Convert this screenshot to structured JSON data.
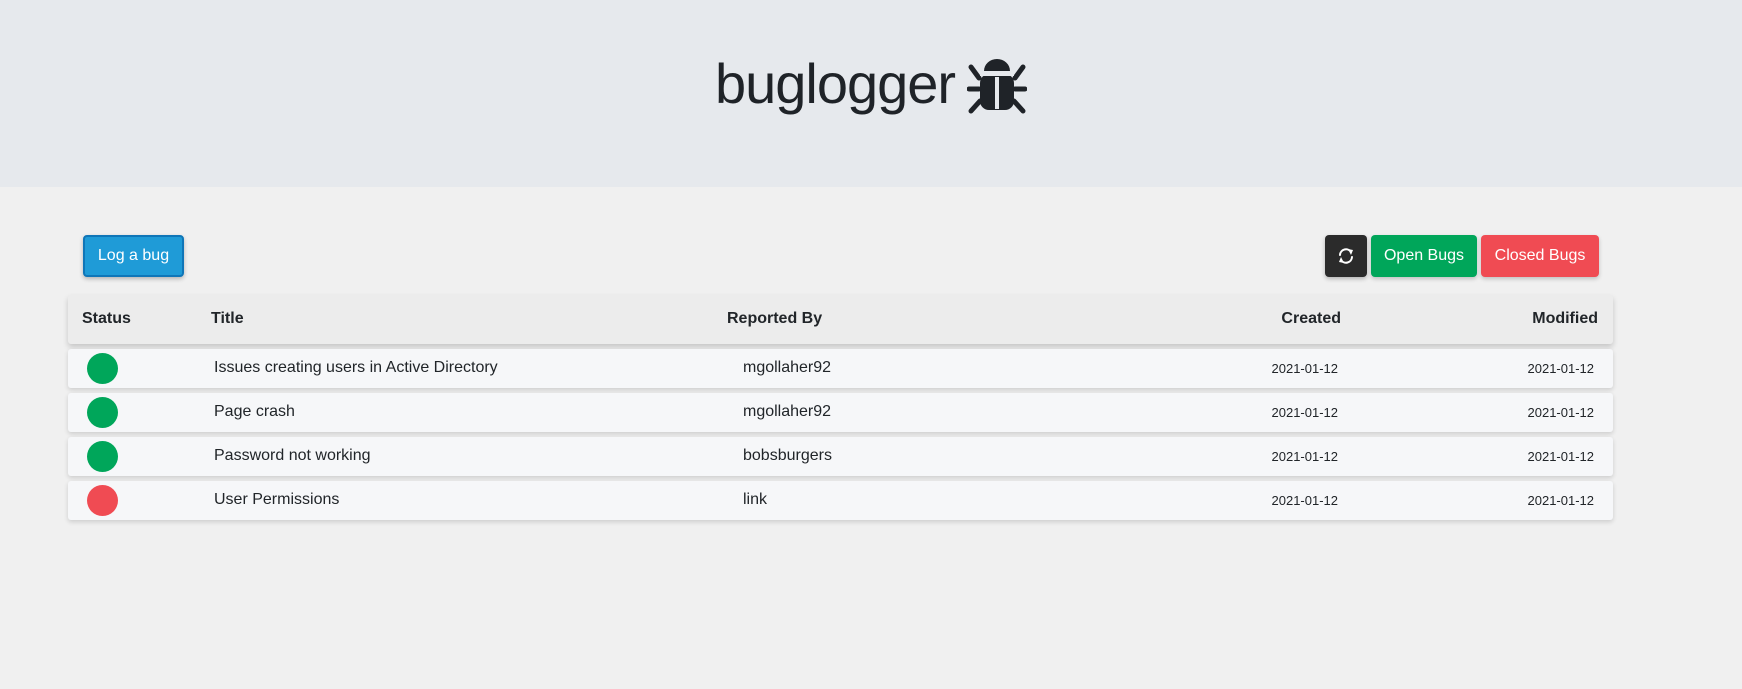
{
  "app": {
    "title": "buglogger",
    "logo_icon": "bug-icon"
  },
  "toolbar": {
    "log_bug_label": "Log a bug",
    "refresh_icon": "refresh-icon",
    "open_bugs_label": "Open Bugs",
    "closed_bugs_label": "Closed Bugs"
  },
  "colors": {
    "header_bg": "#e6e9ed",
    "page_bg": "#f0f0f0",
    "primary": "#1f9bd7",
    "open": "#00a65a",
    "closed": "#f04b53",
    "dark": "#2b2b2b"
  },
  "table": {
    "headers": {
      "status": "Status",
      "title": "Title",
      "reported_by": "Reported By",
      "created": "Created",
      "modified": "Modified"
    },
    "rows": [
      {
        "status": "open",
        "status_color": "#00a65a",
        "title": "Issues creating users in Active Directory",
        "reported_by": "mgollaher92",
        "created": "2021-01-12",
        "modified": "2021-01-12"
      },
      {
        "status": "open",
        "status_color": "#00a65a",
        "title": "Page crash",
        "reported_by": "mgollaher92",
        "created": "2021-01-12",
        "modified": "2021-01-12"
      },
      {
        "status": "open",
        "status_color": "#00a65a",
        "title": "Password not working",
        "reported_by": "bobsburgers",
        "created": "2021-01-12",
        "modified": "2021-01-12"
      },
      {
        "status": "closed",
        "status_color": "#f04b53",
        "title": "User Permissions",
        "reported_by": "link",
        "created": "2021-01-12",
        "modified": "2021-01-12"
      }
    ]
  }
}
